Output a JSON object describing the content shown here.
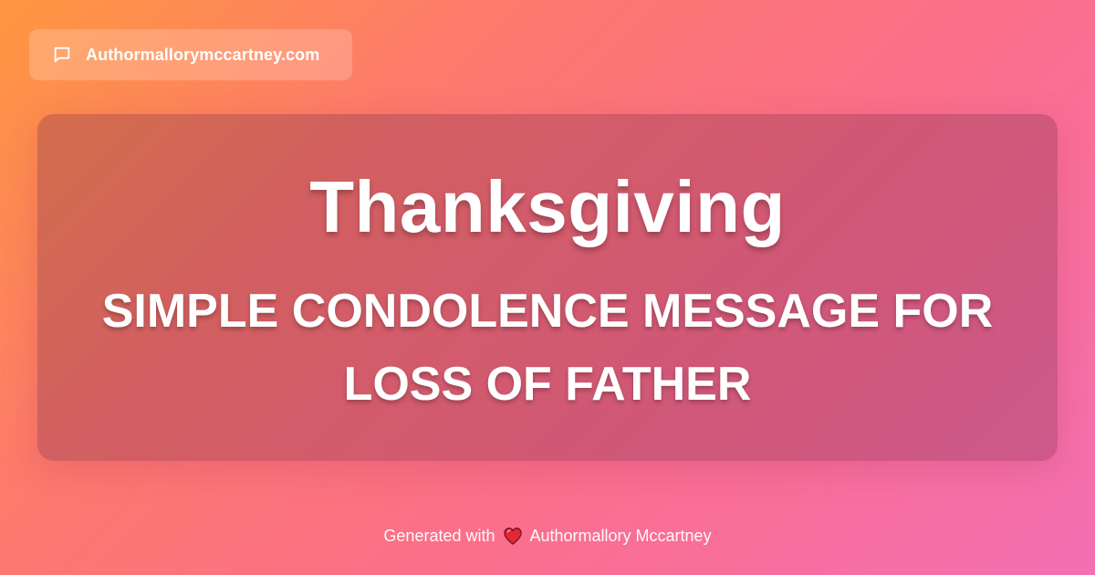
{
  "header": {
    "site_name": "Authormallorymccartney.com",
    "icon": "chat-bubble-icon"
  },
  "card": {
    "title": "Thanksgiving",
    "subtitle": "SIMPLE CONDOLENCE MESSAGE FOR LOSS OF FATHER"
  },
  "footer": {
    "prefix": "Generated with",
    "icon": "heart-icon",
    "author": "Authormallory Mccartney"
  },
  "colors": {
    "gradient_start": "#ff9740",
    "gradient_end": "#f46fb3",
    "heart": "#e0283a",
    "text": "#ffffff"
  }
}
